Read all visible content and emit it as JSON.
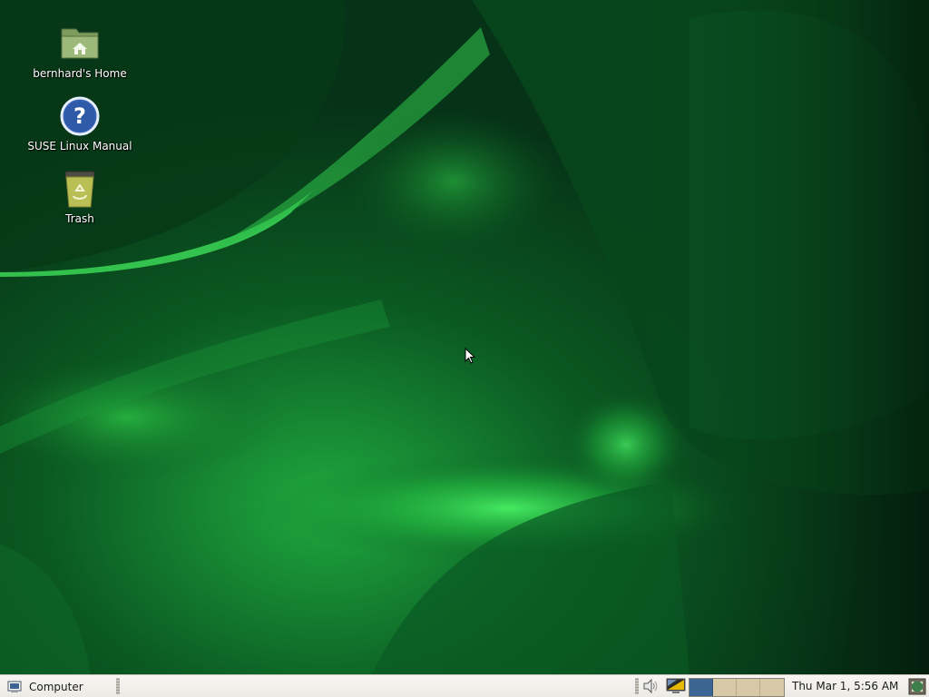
{
  "desktop": {
    "icons": [
      {
        "label": "bernhard's Home",
        "icon": "home-folder-icon"
      },
      {
        "label": "SUSE Linux Manual",
        "icon": "help-icon"
      },
      {
        "label": "Trash",
        "icon": "trash-icon"
      }
    ],
    "wallpaper_colors": {
      "dark": "#062a12",
      "mid": "#0f6b2a",
      "bright": "#3ee05a"
    }
  },
  "panel": {
    "menu_label": "Computer",
    "menu_icon": "computer-icon",
    "tray_icons": [
      "volume-icon",
      "display-settings-icon"
    ],
    "workspaces": [
      {
        "name": "workspace-1",
        "active": true
      },
      {
        "name": "workspace-2",
        "active": false
      },
      {
        "name": "workspace-3",
        "active": false
      },
      {
        "name": "workspace-4",
        "active": false
      }
    ],
    "clock": "Thu Mar  1,  5:56 AM",
    "show_desktop_icon": "show-desktop-icon",
    "colors": {
      "panel_bg": "#eceae4",
      "workspace_active": "#3d6594",
      "workspace_inactive": "#d7c8a6"
    }
  }
}
